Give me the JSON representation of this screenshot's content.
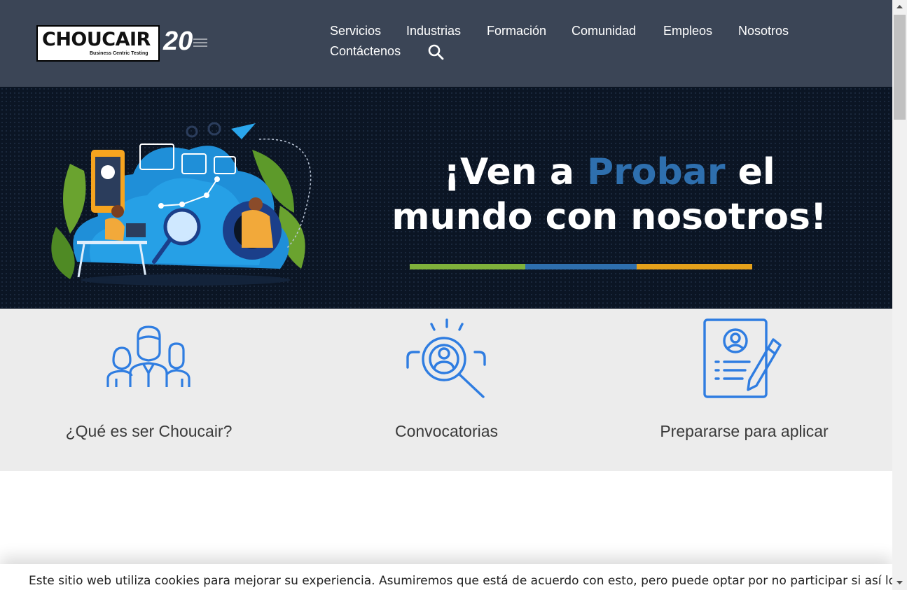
{
  "brand": {
    "logo_text": "CHOUCAIR",
    "logo_tagline": "Business Centric Testing",
    "anniversary": "20"
  },
  "nav": {
    "items": [
      "Servicios",
      "Industrias",
      "Formación",
      "Comunidad",
      "Empleos",
      "Nosotros",
      "Contáctenos"
    ],
    "search_icon": "search-icon"
  },
  "hero": {
    "title_part1": "¡Ven a ",
    "title_accent": "Probar",
    "title_part2": " el",
    "title_line2": "mundo con nosotros!",
    "bar_colors": [
      "#7fb13b",
      "#2e6fae",
      "#e5a11b"
    ],
    "accent_color": "#2e6fae"
  },
  "cards": [
    {
      "label": "¿Qué es ser Choucair?",
      "icon": "team-icon"
    },
    {
      "label": "Convocatorias",
      "icon": "search-candidate-icon"
    },
    {
      "label": "Prepararse para aplicar",
      "icon": "resume-form-icon"
    }
  ],
  "cookie": {
    "text": "Este sitio web utiliza cookies para mejorar su experiencia. Asumiremos que está de acuerdo con esto, pero puede optar por no participar si así lo"
  },
  "colors": {
    "header_bg": "#3b4556",
    "icon_blue": "#2f7de1",
    "cards_bg": "#ececec"
  }
}
